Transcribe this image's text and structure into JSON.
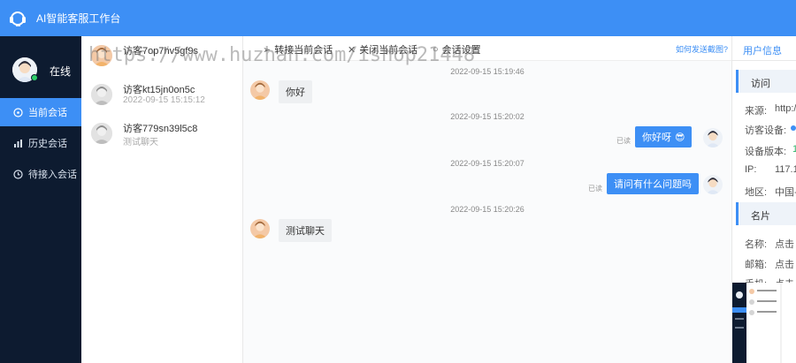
{
  "header": {
    "title": "AI智能客服工作台",
    "bg_color": "#3d8ff5"
  },
  "sidebar": {
    "status": "在线",
    "items": [
      {
        "label": "当前会话",
        "icon": "chat-bubble-icon",
        "active": true
      },
      {
        "label": "历史会话",
        "icon": "bar-chart-icon",
        "active": false
      },
      {
        "label": "待接入会话",
        "icon": "clock-icon",
        "active": false
      }
    ]
  },
  "conversations": [
    {
      "name": "访客7op7hv5gf9s",
      "sub": ""
    },
    {
      "name": "访客kt15jn0on5c",
      "sub": "2022-09-15 15:15:12"
    },
    {
      "name": "访客779sn39l5c8",
      "sub": "测试聊天"
    }
  ],
  "toolbar": {
    "transfer": "转接当前会话",
    "close": "关闭当前会话",
    "settings": "会话设置",
    "screenshot_link": "如何发送截图?"
  },
  "messages": [
    {
      "time": "2022-09-15 15:19:46",
      "side": "left",
      "text": "你好"
    },
    {
      "time": "2022-09-15 15:20:02",
      "side": "right",
      "text": "你好呀",
      "read": "已读"
    },
    {
      "time": "2022-09-15 15:20:07",
      "side": "right",
      "text": "请问有什么问题吗",
      "read": "已读"
    },
    {
      "time": "2022-09-15 15:20:26",
      "side": "left",
      "text": "测试聊天"
    }
  ],
  "right_panel": {
    "tab": "用户信息",
    "visit_section": "访问",
    "visit_rows": [
      {
        "label": "来源:",
        "value": "http:/"
      },
      {
        "label": "访客设备:",
        "value": ""
      },
      {
        "label": "设备版本:",
        "value": "1"
      },
      {
        "label": "IP:",
        "value": "117.1"
      },
      {
        "label": "地区:",
        "value": "中国-"
      }
    ],
    "card_section": "名片",
    "card_rows": [
      {
        "label": "名称:",
        "value": "点击"
      },
      {
        "label": "邮箱:",
        "value": "点击"
      },
      {
        "label": "手机:",
        "value": "点击"
      }
    ]
  },
  "watermark": "https://www.huzhan.com/ishop21448"
}
